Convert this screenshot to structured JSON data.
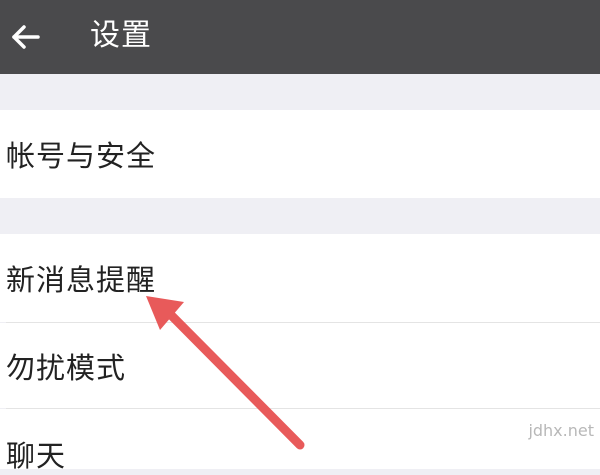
{
  "header": {
    "title": "设置",
    "back_icon": "arrow-left-icon",
    "background": "#4a4a4c"
  },
  "settings": {
    "items": [
      {
        "label": "帐号与安全"
      },
      {
        "label": "新消息提醒"
      },
      {
        "label": "勿扰模式"
      },
      {
        "label": "聊天"
      }
    ]
  },
  "annotation": {
    "arrow_color": "#e85a5a"
  },
  "watermark": {
    "text": "jdhx.net"
  }
}
